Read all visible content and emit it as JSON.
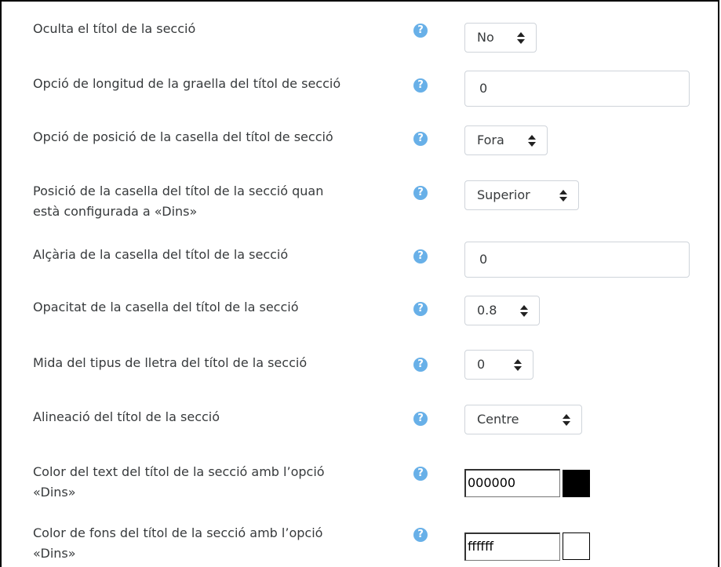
{
  "settings": [
    {
      "label": "Oculta el títol de la secció",
      "type": "select",
      "value": "No"
    },
    {
      "label": "Opció de longitud de la graella del títol de secció",
      "type": "input",
      "value": "0"
    },
    {
      "label": "Opció de posició de la casella del títol de secció",
      "type": "select",
      "value": "Fora"
    },
    {
      "label_line1": "Posició de la casella del títol de la secció quan",
      "label_line2": "està configurada a «Dins»",
      "type": "select",
      "value": "Superior"
    },
    {
      "label": "Alçària de la casella del títol de la secció",
      "type": "input",
      "value": "0"
    },
    {
      "label": "Opacitat de la casella del títol de la secció",
      "type": "select",
      "value": "0.8"
    },
    {
      "label": "Mida del tipus de lletra del títol de la secció",
      "type": "select",
      "value": "0"
    },
    {
      "label": "Alineació del títol de la secció",
      "type": "select",
      "value": "Centre"
    },
    {
      "label_line1": "Color del text del títol de la secció amb l’opció",
      "label_line2": "«Dins»",
      "type": "color",
      "value": "000000",
      "swatch": "#000000"
    },
    {
      "label_line1": "Color de fons del títol de la secció amb l’opció",
      "label_line2": "«Dins»",
      "type": "color",
      "value": "ffffff",
      "swatch": "#ffffff"
    }
  ],
  "help_icon": "question-circle-icon",
  "help_symbol": "?",
  "colors": {
    "text": "#373a3c",
    "help": "#68b0e8",
    "border": "#cfd4da"
  }
}
